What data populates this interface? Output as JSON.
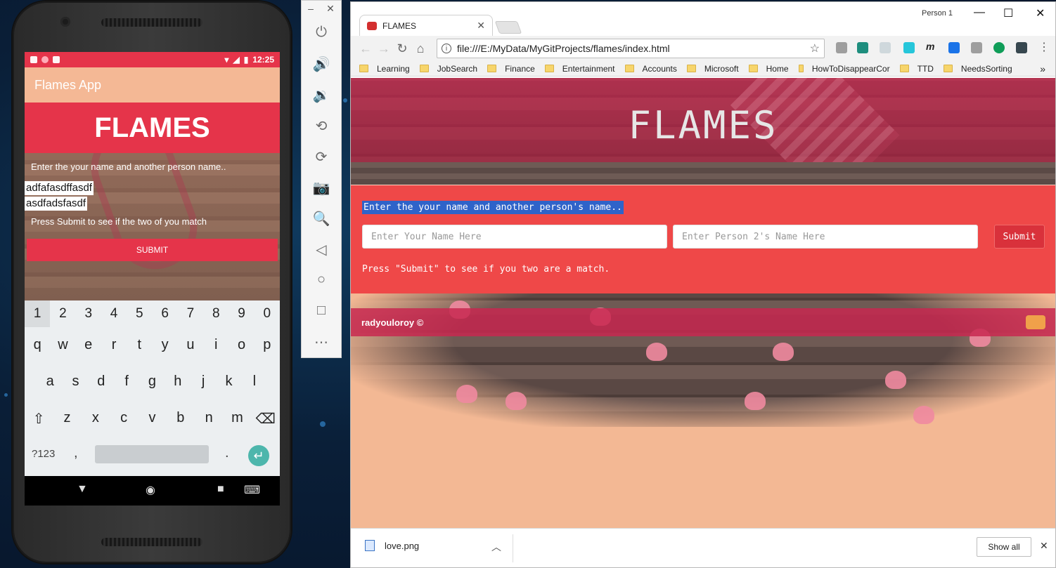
{
  "phone": {
    "status_time": "12:25",
    "app_title": "Flames App",
    "banner": "FLAMES",
    "instruction": "Enter the your name and another person name..",
    "name1_value": "adfafasdffasdf",
    "name2_value": "asdfadsfasdf",
    "press_text": "Press Submit to see if the two of you match",
    "submit_label": "SUBMIT",
    "keyboard": {
      "num_row": [
        "1",
        "2",
        "3",
        "4",
        "5",
        "6",
        "7",
        "8",
        "9",
        "0"
      ],
      "row1": [
        "q",
        "w",
        "e",
        "r",
        "t",
        "y",
        "u",
        "i",
        "o",
        "p"
      ],
      "row2": [
        "a",
        "s",
        "d",
        "f",
        "g",
        "h",
        "j",
        "k",
        "l"
      ],
      "row3": [
        "z",
        "x",
        "c",
        "v",
        "b",
        "n",
        "m"
      ],
      "symbols_label": "?123",
      "comma": ",",
      "period": "."
    }
  },
  "browser": {
    "tab_title": "FLAMES",
    "profile": "Person 1",
    "url": "file:///E:/MyData/MyGitProjects/flames/index.html",
    "bookmarks": [
      "Learning",
      "JobSearch",
      "Finance",
      "Entertainment",
      "Accounts",
      "Microsoft",
      "Home",
      "HowToDisappearCor",
      "TTD",
      "NeedsSorting"
    ],
    "bookmarks_overflow": "»"
  },
  "page": {
    "hero_title": "FLAMES",
    "instruction": "Enter the your name and another person's name..",
    "name1_placeholder": "Enter Your Name Here",
    "name2_placeholder": "Enter Person 2's Name Here",
    "submit_label": "Submit",
    "press_text": "Press \"Submit\" to see if you two are a match.",
    "footer": "radyouloroy ©"
  },
  "downloads": {
    "file_name": "love.png",
    "show_all": "Show all"
  },
  "colors": {
    "brand_red": "#e5344a",
    "peach": "#f4b895",
    "form_red": "#ef4848",
    "selection_blue": "#2f63c9"
  }
}
